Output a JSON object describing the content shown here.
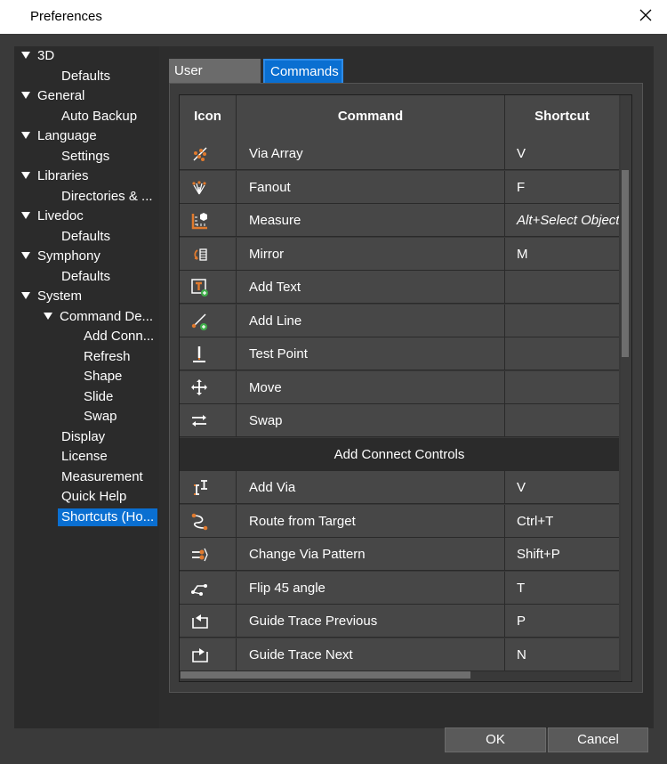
{
  "window": {
    "title": "Preferences"
  },
  "tree": [
    {
      "label": "3D",
      "level": 0,
      "expanded": true
    },
    {
      "label": "Defaults",
      "level": 2
    },
    {
      "label": "General",
      "level": 0,
      "expanded": true
    },
    {
      "label": "Auto Backup",
      "level": 2
    },
    {
      "label": "Language",
      "level": 0,
      "expanded": true
    },
    {
      "label": "Settings",
      "level": 2
    },
    {
      "label": "Libraries",
      "level": 0,
      "expanded": true
    },
    {
      "label": "Directories & ...",
      "level": 2
    },
    {
      "label": "Livedoc",
      "level": 0,
      "expanded": true
    },
    {
      "label": "Defaults",
      "level": 2
    },
    {
      "label": "Symphony",
      "level": 0,
      "expanded": true
    },
    {
      "label": "Defaults",
      "level": 2
    },
    {
      "label": "System",
      "level": 0,
      "expanded": true
    },
    {
      "label": "Command De...",
      "level": 1,
      "expanded": true
    },
    {
      "label": "Add Conn...",
      "level": 3
    },
    {
      "label": "Refresh",
      "level": 3
    },
    {
      "label": "Shape",
      "level": 3
    },
    {
      "label": "Slide",
      "level": 3
    },
    {
      "label": "Swap",
      "level": 3
    },
    {
      "label": "Display",
      "level": 2
    },
    {
      "label": "License",
      "level": 2
    },
    {
      "label": "Measurement",
      "level": 2
    },
    {
      "label": "Quick Help",
      "level": 2
    },
    {
      "label": "Shortcuts (Ho...",
      "level": 2,
      "selected": true
    }
  ],
  "tabs": {
    "user_interface": "User Interface",
    "commands": "Commands"
  },
  "table": {
    "headers": {
      "icon": "Icon",
      "command": "Command",
      "shortcut": "Shortcut"
    },
    "rows": [
      {
        "icon": "via-array-icon",
        "command": "Via Array",
        "shortcut": "V"
      },
      {
        "icon": "fanout-icon",
        "command": "Fanout",
        "shortcut": "F"
      },
      {
        "icon": "measure-icon",
        "command": "Measure",
        "shortcut": "Alt+Select Objects",
        "italic": true
      },
      {
        "icon": "mirror-icon",
        "command": "Mirror",
        "shortcut": "M"
      },
      {
        "icon": "add-text-icon",
        "command": "Add Text",
        "shortcut": ""
      },
      {
        "icon": "add-line-icon",
        "command": "Add Line",
        "shortcut": ""
      },
      {
        "icon": "test-point-icon",
        "command": "Test Point",
        "shortcut": ""
      },
      {
        "icon": "move-icon",
        "command": "Move",
        "shortcut": ""
      },
      {
        "icon": "swap-icon",
        "command": "Swap",
        "shortcut": ""
      },
      {
        "section": "Add Connect Controls"
      },
      {
        "icon": "add-via-icon",
        "command": "Add Via",
        "shortcut": "V"
      },
      {
        "icon": "route-from-target-icon",
        "command": "Route from Target",
        "shortcut": "Ctrl+T"
      },
      {
        "icon": "change-via-pattern-icon",
        "command": "Change Via Pattern",
        "shortcut": "Shift+P"
      },
      {
        "icon": "flip-45-angle-icon",
        "command": "Flip 45 angle",
        "shortcut": "T"
      },
      {
        "icon": "guide-trace-previous-icon",
        "command": "Guide Trace Previous",
        "shortcut": "P"
      },
      {
        "icon": "guide-trace-next-icon",
        "command": "Guide Trace Next",
        "shortcut": "N"
      }
    ]
  },
  "buttons": {
    "ok": "OK",
    "cancel": "Cancel"
  },
  "colors": {
    "accent": "#0a6fd1",
    "icon_orange": "#e07a2e",
    "icon_green": "#3fae49"
  }
}
